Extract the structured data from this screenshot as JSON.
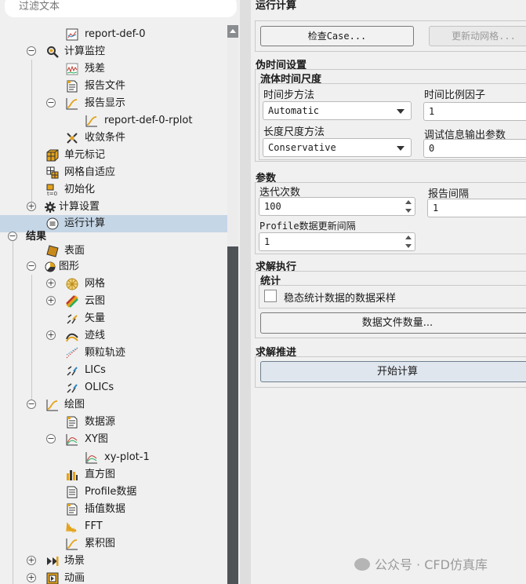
{
  "filter": {
    "placeholder": "过滤文本"
  },
  "tree": [
    {
      "label": "report-def-0",
      "icon": "report-def-icon"
    },
    {
      "label": "计算监控",
      "icon": "monitor-icon"
    },
    {
      "label": "残差",
      "icon": "residual-icon"
    },
    {
      "label": "报告文件",
      "icon": "report-file-icon"
    },
    {
      "label": "报告显示",
      "icon": "report-plot-icon"
    },
    {
      "label": "report-def-0-rplot",
      "icon": "rplot-icon"
    },
    {
      "label": "收敛条件",
      "icon": "convergence-icon"
    },
    {
      "label": "单元标记",
      "icon": "cell-register-icon"
    },
    {
      "label": "网格自适应",
      "icon": "mesh-adapt-icon"
    },
    {
      "label": "初始化",
      "icon": "initialization-icon"
    },
    {
      "label": "计算设置",
      "icon": "gear-icon"
    },
    {
      "label": "运行计算",
      "icon": "run-calculation-icon"
    },
    {
      "label": "结果",
      "icon": ""
    },
    {
      "label": "表面",
      "icon": "surface-icon"
    },
    {
      "label": "图形",
      "icon": "graphics-icon"
    },
    {
      "label": "网格",
      "icon": "mesh-icon"
    },
    {
      "label": "云图",
      "icon": "contour-icon"
    },
    {
      "label": "矢量",
      "icon": "vector-icon"
    },
    {
      "label": "迹线",
      "icon": "pathline-icon"
    },
    {
      "label": "颗粒轨迹",
      "icon": "particle-track-icon"
    },
    {
      "label": "LICs",
      "icon": "lic-icon"
    },
    {
      "label": "OLICs",
      "icon": "olic-icon"
    },
    {
      "label": "绘图",
      "icon": "plot-icon"
    },
    {
      "label": "数据源",
      "icon": "data-source-icon"
    },
    {
      "label": "XY图",
      "icon": "xy-plot-icon"
    },
    {
      "label": "xy-plot-1",
      "icon": "xy-plot-item-icon"
    },
    {
      "label": "直方图",
      "icon": "histogram-icon"
    },
    {
      "label": "Profile数据",
      "icon": "profile-data-icon"
    },
    {
      "label": "插值数据",
      "icon": "interpolated-data-icon"
    },
    {
      "label": "FFT",
      "icon": "fft-icon"
    },
    {
      "label": "累积图",
      "icon": "cumulative-plot-icon"
    },
    {
      "label": "场景",
      "icon": "scene-icon"
    },
    {
      "label": "动画",
      "icon": "animation-icon"
    }
  ],
  "panel": {
    "title": "运行计算",
    "check_case": "检查Case...",
    "update_mesh": "更新动网格...",
    "pseudo_time": "伪时间设置",
    "fluid_time_scale": "流体时间尺度",
    "time_step_method": "时间步方法",
    "time_step_method_value": "Automatic",
    "time_scale_factor": "时间比例因子",
    "time_scale_factor_value": "1",
    "length_scale_method": "长度尺度方法",
    "length_scale_method_value": "Conservative",
    "verbosity": "调试信息输出参数",
    "verbosity_value": "0",
    "params": "参数",
    "iterations": "迭代次数",
    "iterations_value": "100",
    "report_interval": "报告间隔",
    "report_interval_value": "1",
    "profile_update": "Profile数据更新间隔",
    "profile_update_value": "1",
    "solution_processing": "求解执行",
    "statistics": "统计",
    "data_sampling": "稳态统计数据的数据采样",
    "data_sampling_checked": false,
    "data_file_quantities": "数据文件数量...",
    "solution_advancement": "求解推进",
    "calculate": "开始计算"
  },
  "watermark": "公众号 · CFD仿真库"
}
